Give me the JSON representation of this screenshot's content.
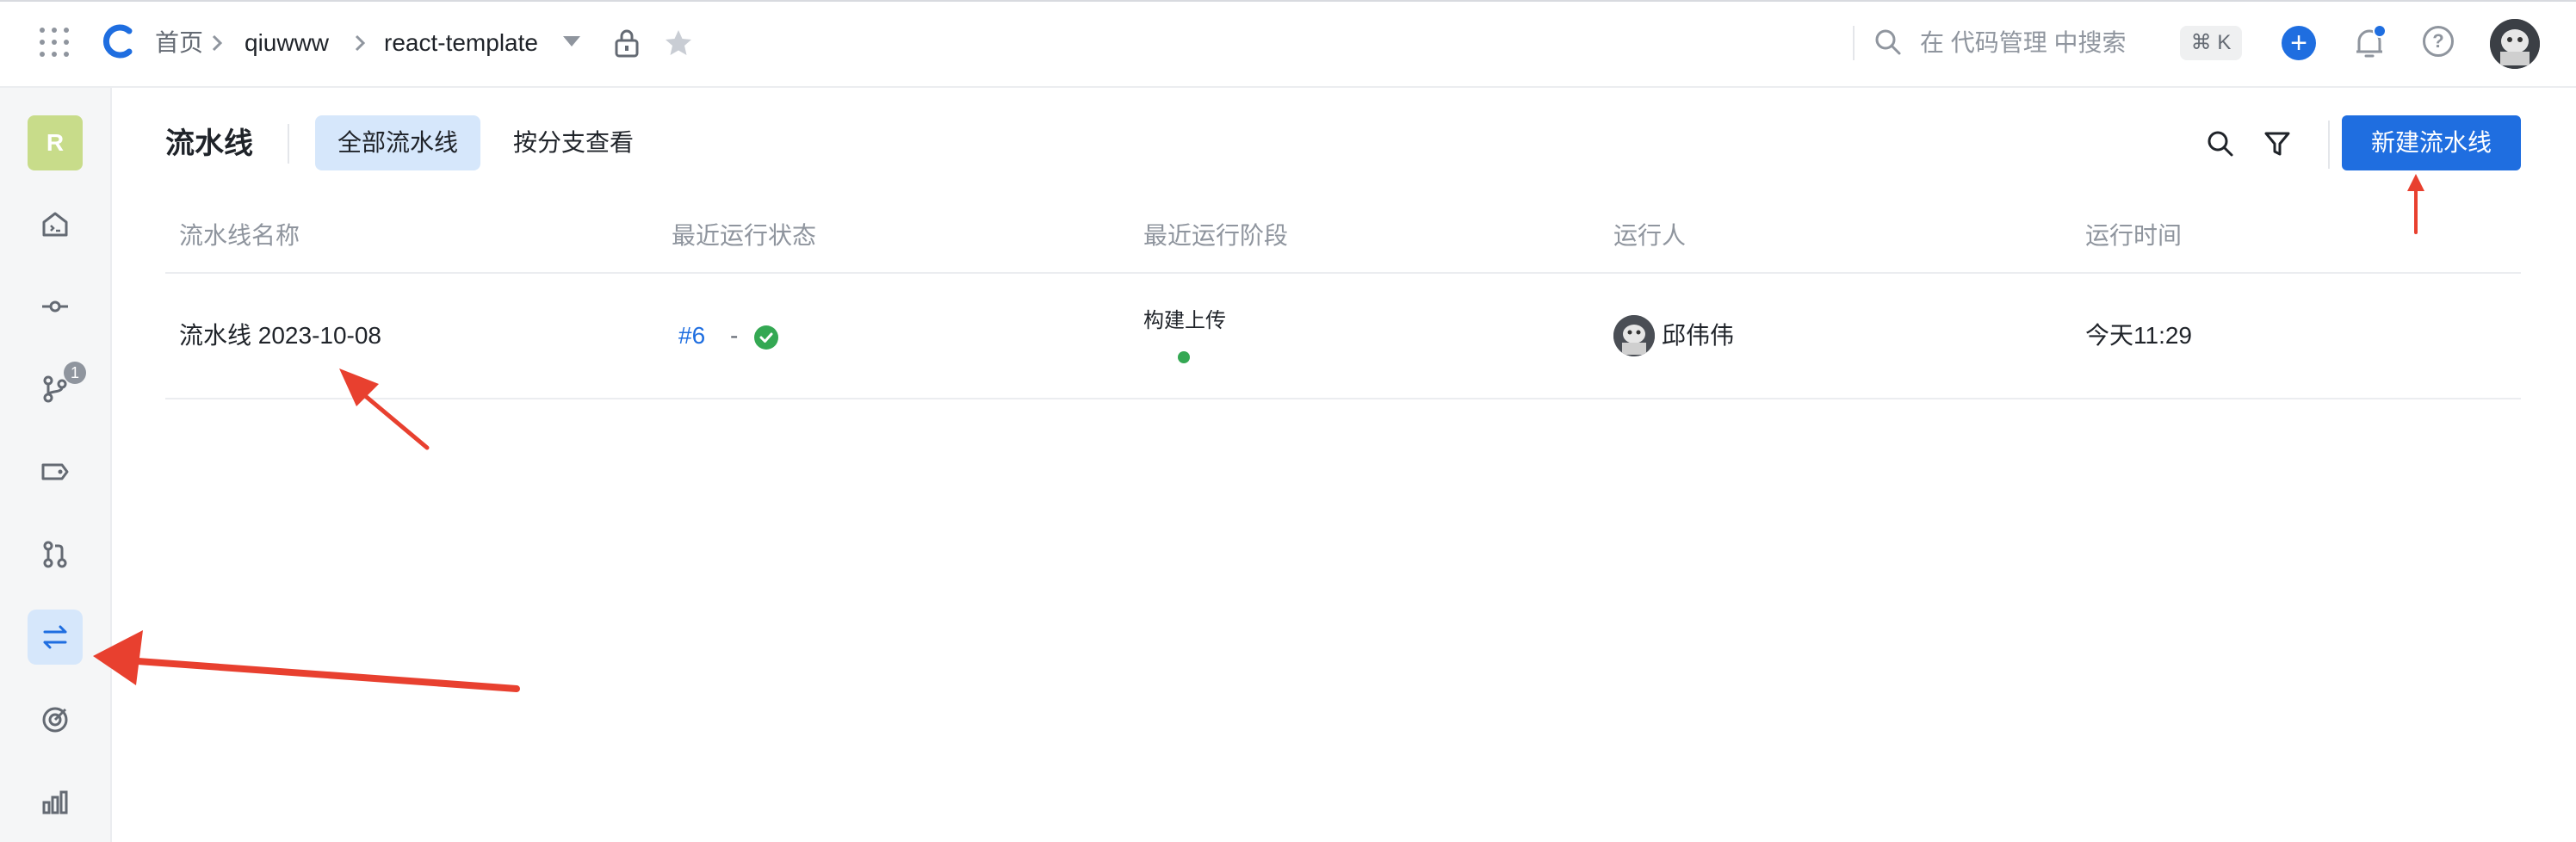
{
  "topbar": {
    "breadcrumb": {
      "home": "首页",
      "user": "qiuwww",
      "repo": "react-template"
    },
    "search_placeholder": "在 代码管理 中搜索",
    "shortcut": "⌘ K",
    "icons": [
      "apps-grid-icon",
      "logo-icon",
      "chevron-right-icon",
      "caret-down-icon",
      "lock-icon",
      "star-icon",
      "search-icon",
      "plus-icon",
      "bell-icon",
      "help-icon",
      "user-avatar"
    ]
  },
  "sidebar": {
    "repo_initial": "R",
    "items": [
      {
        "name": "code-home-icon",
        "active": false
      },
      {
        "name": "commit-icon",
        "active": false
      },
      {
        "name": "branch-icon",
        "active": false,
        "badge": "1"
      },
      {
        "name": "tag-icon",
        "active": false
      },
      {
        "name": "merge-request-icon",
        "active": false
      },
      {
        "name": "pipeline-icon",
        "active": true
      },
      {
        "name": "target-icon",
        "active": false
      },
      {
        "name": "stats-icon",
        "active": false
      }
    ]
  },
  "main": {
    "title": "流水线",
    "tabs": [
      {
        "label": "全部流水线",
        "active": true
      },
      {
        "label": "按分支查看",
        "active": false
      }
    ],
    "new_button": "新建流水线",
    "columns": [
      "流水线名称",
      "最近运行状态",
      "最近运行阶段",
      "运行人",
      "运行时间"
    ],
    "rows": [
      {
        "name": "流水线 2023-10-08",
        "run_number": "#6",
        "status_sep": "-",
        "status": "success",
        "stage": "构建上传",
        "runner": "邱伟伟",
        "time": "今天11:29"
      }
    ]
  },
  "colors": {
    "accent": "#1f6ee0",
    "success": "#34a853",
    "annotation": "#e8402f",
    "active_bg": "#d6e7fb"
  }
}
